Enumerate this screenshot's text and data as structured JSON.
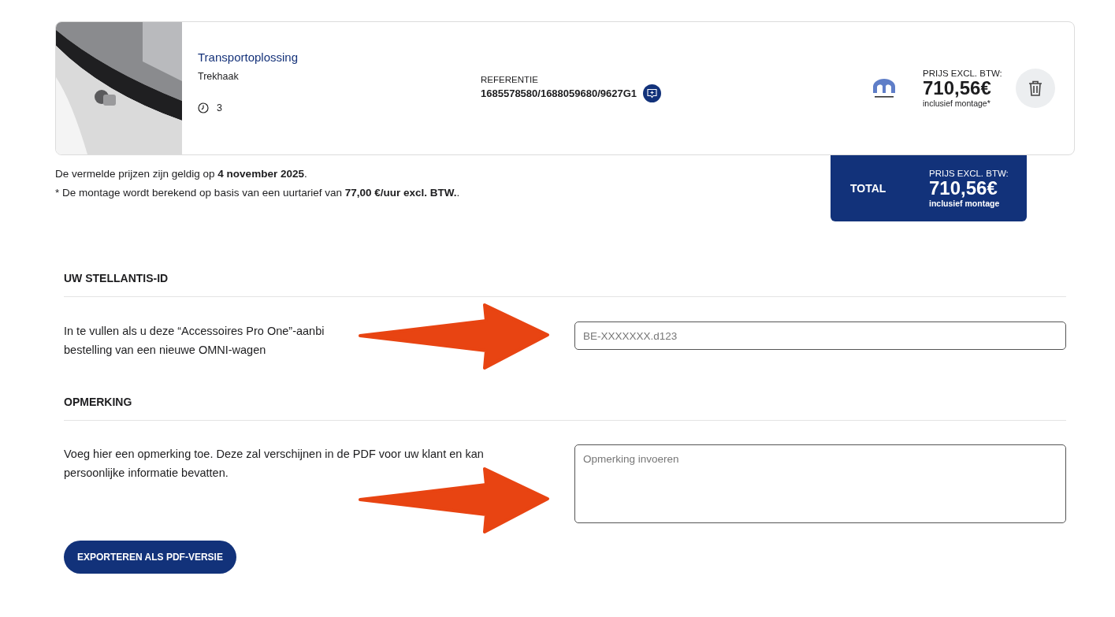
{
  "product": {
    "title": "Transportoplossing",
    "subtitle": "Trekhaak",
    "duration": "3",
    "reference_label": "REFERENTIE",
    "reference": "1685578580/1688059680/9627G1",
    "price_label": "PRIJS EXCL. BTW:",
    "price": "710,56€",
    "price_note": "inclusief montage*"
  },
  "notes": [
    "De vermelde prijzen zijn geldig op **4 november 2025**.",
    "* De montage wordt berekend op basis van een uurtarief van **77,00 €/uur excl. BTW.**."
  ],
  "total": {
    "label": "TOTAL",
    "price_label": "PRIJS EXCL. BTW:",
    "price": "710,56€",
    "price_note": "inclusief montage"
  },
  "sections": [
    {
      "kind": "input",
      "heading": "UW STELLANTIS-ID",
      "description_lines": [
        "In te vullen als u deze “Accessoires Pro One”-aanbi",
        "bestelling van een nieuwe OMNI-wagen"
      ],
      "placeholder": "BE-XXXXXXX.d123"
    },
    {
      "kind": "textarea",
      "heading": "OPMERKING",
      "description_lines": [
        "Voeg hier een opmerking toe. Deze zal verschijnen in de PDF voor uw klant en kan",
        "persoonlijke informatie bevatten."
      ],
      "placeholder": "Opmerking invoeren"
    }
  ],
  "export_button": "EXPORTEREN ALS PDF-VERSIE"
}
